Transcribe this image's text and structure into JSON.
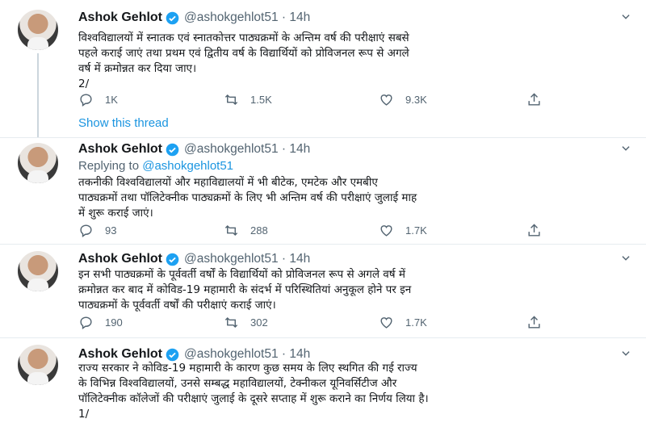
{
  "tweets": [
    {
      "name": "Ashok Gehlot",
      "handle": "@ashokgehlot51 · 14h",
      "lines": [
        "विश्वविद्यालयों में स्नातक एवं स्नातकोत्तर पाठ्यक्रमों के अन्तिम वर्ष की परीक्षाएं सबसे",
        "पहले कराई जाएं तथा प्रथम एवं द्वितीय वर्ष के विद्यार्थियों को प्रोविजनल रूप से अगले",
        "वर्ष में क्रमोन्नत कर दिया जाए।",
        "2/"
      ],
      "reply": "1K",
      "retweet": "1.5K",
      "like": "9.3K"
    },
    {
      "name": "Ashok Gehlot",
      "handle": "@ashokgehlot51 · 14h",
      "replying_label": "Replying to",
      "replying_to": "@ashokgehlot51",
      "lines": [
        "तकनीकी विश्वविद्यालयों और महाविद्यालयों में भी बीटेक, एमटेक और एमबीए",
        "पाठ्यक्रमों तथा पॉलिटेक्नीक पाठ्यक्रमों के लिए भी अन्तिम वर्ष की परीक्षाएं जुलाई माह",
        "में शुरू कराई जाएं।"
      ],
      "reply": "93",
      "retweet": "288",
      "like": "1.7K"
    },
    {
      "name": "Ashok Gehlot",
      "handle": "@ashokgehlot51 · 14h",
      "lines": [
        "इन सभी पाठ्यक्रमों के पूर्ववर्ती वर्षों के विद्यार्थियों को प्रोविजनल रूप से अगले वर्ष में",
        "क्रमोन्नत कर बाद में कोविड-19 महामारी के संदर्भ में परिस्थितियां अनुकूल होने पर इन",
        "पाठ्यक्रमों के पूर्ववर्ती वर्षों की परीक्षाएं कराई जाएं।"
      ],
      "reply": "190",
      "retweet": "302",
      "like": "1.7K"
    },
    {
      "name": "Ashok Gehlot",
      "handle": "@ashokgehlot51 · 14h",
      "lines": [
        "राज्य सरकार ने कोविड-19 महामारी के कारण कुछ समय के लिए  स्थगित की गई राज्य",
        "के विभिन्न विश्वविद्यालयों, उनसे सम्बद्ध महाविद्यालयों, टेक्नीकल यूनिवर्सिटीज और",
        "पॉलिटेक्नीक कॉलेजों की परीक्षाएं जुलाई के दूसरे सप्ताह में शुरू कराने का निर्णय लिया है।",
        "1/"
      ]
    }
  ],
  "show_thread": "Show this thread",
  "colors": {
    "link": "#1b95e0",
    "verified": "#1da1f2",
    "muted": "#536471"
  }
}
